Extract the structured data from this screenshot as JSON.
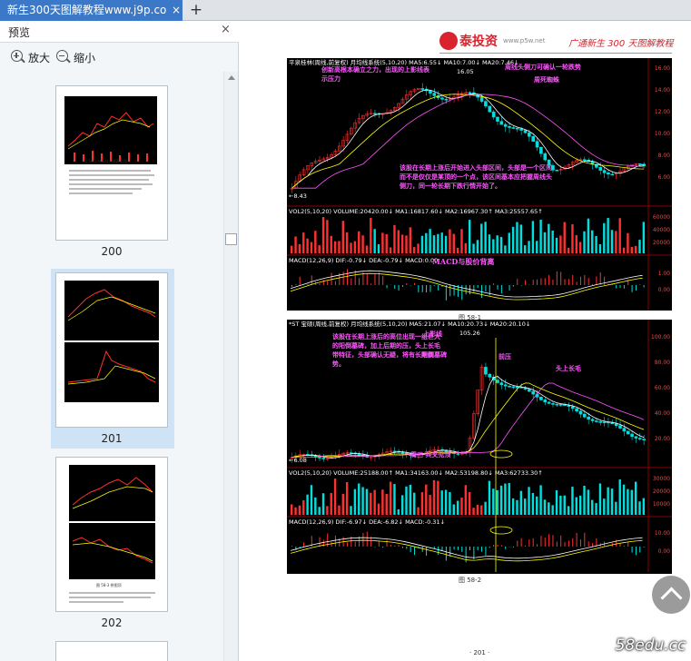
{
  "tab": {
    "title": "新生300天图解教程www.j9p.co",
    "close": "×",
    "add": "+"
  },
  "panel": {
    "title": "预览",
    "close": "×",
    "zoom_in": "放大",
    "zoom_out": "缩小",
    "thumbnails": [
      {
        "page": "200",
        "caption": "图 58-1 在高位上涨高见顶"
      },
      {
        "page": "201"
      },
      {
        "page": "202",
        "caption": "图 58-3 拼图顶"
      }
    ]
  },
  "document": {
    "logo": "泰投资",
    "logo_sub": "www.p5w.net",
    "header_right": "广通新生 300 天图解教程",
    "chart1": {
      "title_bar": "平泉桂林(周线,前复权)  月均线系统(5,10,20)  MA5:6.55↓  MA10:7.00↓  MA20:7.46↓",
      "high_label": "16.05",
      "low_label": "←8.43",
      "annotations": [
        "创新高根本确立之力，出现的上影线表示压力",
        "周线头侧刀可确认一轮跌势",
        "周死蜘蛛",
        "该股在长期上涨后开始进入头部区间，头部是一个区间而不是仅仅是某顶的一个点，该区间基本应把握周线头侧刀，同一轮长期下跌行情开始了。"
      ],
      "price_ticks": [
        "16.00",
        "14.00",
        "12.00",
        "10.00",
        "8.00",
        "6.00"
      ],
      "vol_bar": "VOL2(5,10,20)  VOLUME:20420.00↓  MA1:16817.60↓  MA2:16967.30↑  MA3:25557.65↑",
      "vol_ticks": [
        "60000",
        "40000",
        "20000"
      ],
      "macd_bar": "MACD(12,26,9)  DIF:-0.79↓  DEA:-0.79↓  MACD:0.00",
      "macd_note": "MACD与股价背离",
      "macd_ticks": [
        "1.00",
        "0.00"
      ],
      "caption": "图 58-1"
    },
    "chart2": {
      "title_bar": "*ST 宝硕(周线,前复权)  月均线系统(5,10,20)  MA5:21.07↓  MA10:20.73↓  MA20:20.10↓",
      "high_label": "105.26",
      "low_label": "←6.08",
      "annotations": [
        "该股在长期上涨后的高位出现一组巨大的阳倒墓碑，加上后期的压，头上长毛带特征，头部确认无疑，将有长期跌势。",
        "上影线",
        "阳倒墓碑",
        "前压",
        "头上长毛",
        "周三 兵叉见顶"
      ],
      "price_ticks": [
        "100.00",
        "80.00",
        "60.00",
        "40.00",
        "20.00"
      ],
      "vol_bar": "VOL2(5,10,20)  VOLUME:25188.00↑  MA1:34163.00↓  MA2:53198.80↓  MA3:62733.30↑",
      "vol_ticks": [
        "30000",
        "20000",
        "10000"
      ],
      "macd_bar": "MACD(12,26,9)  DIF:-6.97↓  DEA:-6.82↓  MACD:-0.31↓",
      "macd_ticks": [
        "10.00",
        "0.00"
      ],
      "caption": "图 58-2"
    },
    "page_number": "· 201 ·"
  },
  "watermark": "58edu.cc",
  "colors": {
    "tab_active": "#3c78c8",
    "brand_red": "#d9232d",
    "chart_bg": "#000000",
    "annot": "#ff55ff"
  }
}
